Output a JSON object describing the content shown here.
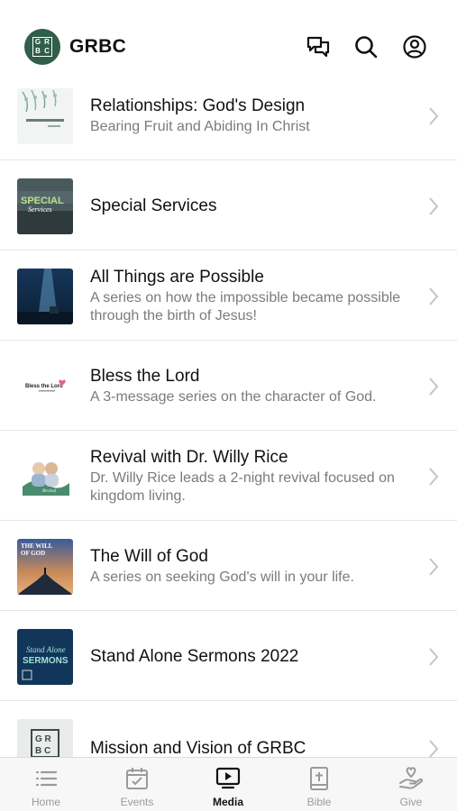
{
  "header": {
    "logo_letters": [
      "G",
      "R",
      "B",
      "C"
    ],
    "app_title": "GRBC",
    "icons": [
      "chat-icon",
      "search-icon",
      "profile-icon"
    ]
  },
  "series": [
    {
      "title": "Relationships: God's Design",
      "subtitle": "Bearing Fruit and Abiding In Christ",
      "thumb_text": "RELATIONSHIPS"
    },
    {
      "title": "Special Services",
      "subtitle": "",
      "thumb_text": "SPECIAL Services"
    },
    {
      "title": "All Things are Possible",
      "subtitle": "A series on how the impossible became possible through the birth of Jesus!",
      "thumb_text": ""
    },
    {
      "title": "Bless the Lord",
      "subtitle": "A 3-message series on the character of God.",
      "thumb_text": "Bless the Lord"
    },
    {
      "title": "Revival with Dr. Willy Rice",
      "subtitle": "Dr. Willy Rice leads a 2-night revival focused on kingdom living.",
      "thumb_text": ""
    },
    {
      "title": "The Will of God",
      "subtitle": "A series on seeking God's will in your life.",
      "thumb_text": "THE WILL OF GOD"
    },
    {
      "title": "Stand Alone Sermons 2022",
      "subtitle": "",
      "thumb_text": "Stand Alone SERMONS"
    },
    {
      "title": "Mission and Vision of GRBC",
      "subtitle": "",
      "thumb_text": "GRBC"
    }
  ],
  "tabbar": {
    "tabs": [
      {
        "label": "Home",
        "icon": "list-icon"
      },
      {
        "label": "Events",
        "icon": "calendar-icon"
      },
      {
        "label": "Media",
        "icon": "tv-play-icon",
        "active": true
      },
      {
        "label": "Bible",
        "icon": "bible-icon"
      },
      {
        "label": "Give",
        "icon": "give-hand-icon"
      }
    ]
  },
  "colors": {
    "brand_green": "#2f5e4a",
    "text_primary": "#111111",
    "text_secondary": "#7b7b7b",
    "divider": "#e6e6e6"
  }
}
